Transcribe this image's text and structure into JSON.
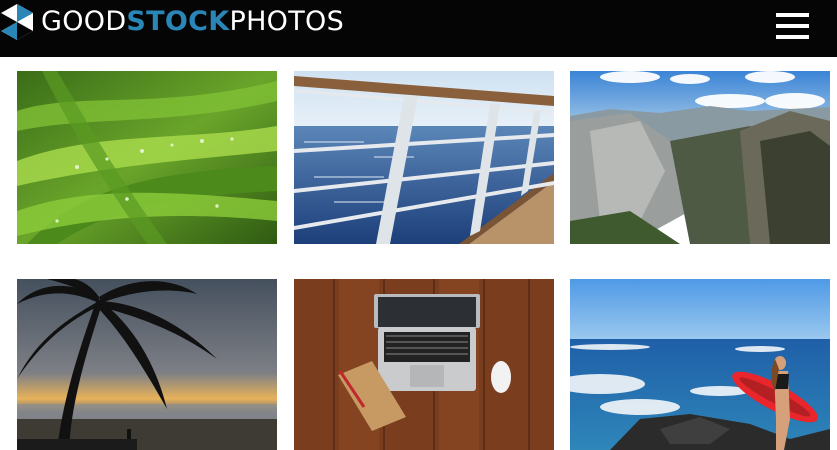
{
  "header": {
    "logo": {
      "part1": "GOOD",
      "part2": "STOCK",
      "part3": "PHOTOS",
      "accent_color": "#2b86b8"
    },
    "menu_icon": "hamburger-menu-icon",
    "background": "#050505"
  },
  "gallery": {
    "photos": [
      {
        "subject": "grass-with-dew-drops"
      },
      {
        "subject": "ship-railing-over-ocean"
      },
      {
        "subject": "mountain-valley-cliffs"
      },
      {
        "subject": "palm-tree-sunset-beach"
      },
      {
        "subject": "laptop-notebook-mouse-on-wood-desk"
      },
      {
        "subject": "surfer-with-red-board-on-rocky-shore"
      }
    ]
  }
}
